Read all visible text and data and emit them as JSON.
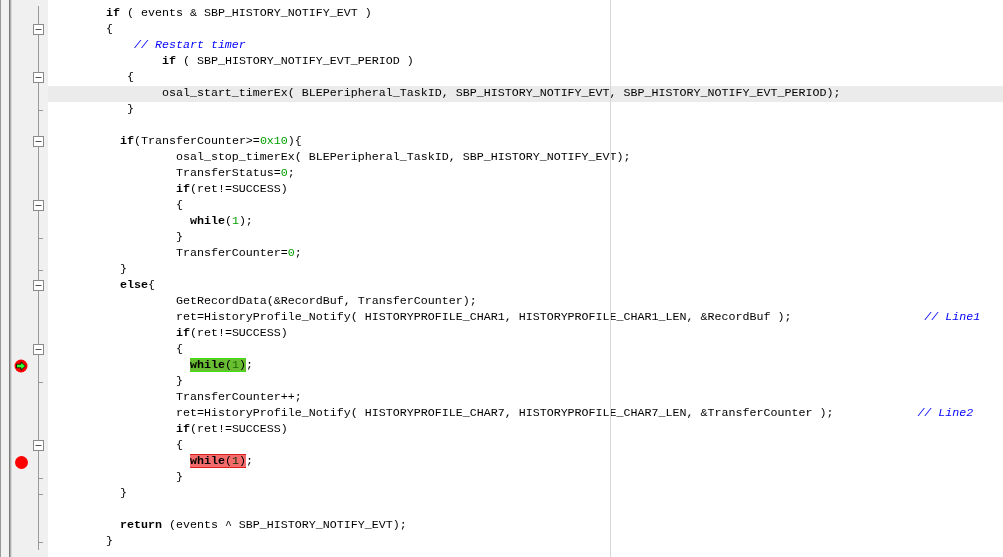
{
  "editor": {
    "lines": [
      {
        "fold_box": false,
        "fold_end": false,
        "breakpoint": false,
        "current": false,
        "cursor": false,
        "tokens": [
          {
            "kind": "keyword",
            "t": "        if"
          },
          {
            "kind": "plain",
            "t": " ( events & SBP_HISTORY_NOTIFY_EVT )"
          }
        ]
      },
      {
        "fold_box": true,
        "fold_end": false,
        "breakpoint": false,
        "current": false,
        "cursor": false,
        "tokens": [
          {
            "kind": "plain",
            "t": "        {"
          }
        ]
      },
      {
        "fold_box": false,
        "fold_end": false,
        "breakpoint": false,
        "current": false,
        "cursor": false,
        "tokens": [
          {
            "kind": "comment",
            "t": "            // Restart timer"
          }
        ]
      },
      {
        "fold_box": false,
        "fold_end": false,
        "breakpoint": false,
        "current": false,
        "cursor": false,
        "tokens": [
          {
            "kind": "keyword",
            "t": "                if"
          },
          {
            "kind": "plain",
            "t": " ( SBP_HISTORY_NOTIFY_EVT_PERIOD )"
          }
        ]
      },
      {
        "fold_box": true,
        "fold_end": false,
        "breakpoint": false,
        "current": false,
        "cursor": false,
        "tokens": [
          {
            "kind": "plain",
            "t": "           {"
          }
        ]
      },
      {
        "fold_box": false,
        "fold_end": false,
        "breakpoint": false,
        "current": false,
        "cursor": true,
        "tokens": [
          {
            "kind": "plain",
            "t": "                osal_start_timerEx( BLEPeripheral_TaskID, SBP_HISTORY_NOTIFY_EVT, SBP_HISTORY_NOTIFY_EVT_PERIOD);"
          }
        ]
      },
      {
        "fold_box": false,
        "fold_end": true,
        "breakpoint": false,
        "current": false,
        "cursor": false,
        "tokens": [
          {
            "kind": "plain",
            "t": "           }"
          }
        ]
      },
      {
        "fold_box": false,
        "fold_end": false,
        "breakpoint": false,
        "current": false,
        "cursor": false
      },
      {
        "fold_box": true,
        "fold_end": false,
        "breakpoint": false,
        "current": false,
        "cursor": false,
        "tokens": [
          {
            "kind": "keyword",
            "t": "          if"
          },
          {
            "kind": "plain",
            "t": "(TransferCounter>="
          },
          {
            "kind": "number",
            "t": "0x10"
          },
          {
            "kind": "plain",
            "t": "){"
          }
        ]
      },
      {
        "fold_box": false,
        "fold_end": false,
        "breakpoint": false,
        "current": false,
        "cursor": false,
        "tokens": [
          {
            "kind": "plain",
            "t": "                  osal_stop_timerEx( BLEPeripheral_TaskID, SBP_HISTORY_NOTIFY_EVT);"
          }
        ]
      },
      {
        "fold_box": false,
        "fold_end": false,
        "breakpoint": false,
        "current": false,
        "cursor": false,
        "tokens": [
          {
            "kind": "plain",
            "t": "                  TransferStatus="
          },
          {
            "kind": "number",
            "t": "0"
          },
          {
            "kind": "plain",
            "t": ";"
          }
        ]
      },
      {
        "fold_box": false,
        "fold_end": false,
        "breakpoint": false,
        "current": false,
        "cursor": false,
        "tokens": [
          {
            "kind": "keyword",
            "t": "                  if"
          },
          {
            "kind": "plain",
            "t": "(ret!=SUCCESS)"
          }
        ]
      },
      {
        "fold_box": true,
        "fold_end": false,
        "breakpoint": false,
        "current": false,
        "cursor": false,
        "tokens": [
          {
            "kind": "plain",
            "t": "                  {"
          }
        ]
      },
      {
        "fold_box": false,
        "fold_end": false,
        "breakpoint": false,
        "current": false,
        "cursor": false,
        "tokens": [
          {
            "kind": "keyword",
            "t": "                    while"
          },
          {
            "kind": "plain",
            "t": "("
          },
          {
            "kind": "number",
            "t": "1"
          },
          {
            "kind": "plain",
            "t": ");"
          }
        ]
      },
      {
        "fold_box": false,
        "fold_end": true,
        "breakpoint": false,
        "current": false,
        "cursor": false,
        "tokens": [
          {
            "kind": "plain",
            "t": "                  }"
          }
        ]
      },
      {
        "fold_box": false,
        "fold_end": false,
        "breakpoint": false,
        "current": false,
        "cursor": false,
        "tokens": [
          {
            "kind": "plain",
            "t": "                  TransferCounter="
          },
          {
            "kind": "number",
            "t": "0"
          },
          {
            "kind": "plain",
            "t": ";"
          }
        ]
      },
      {
        "fold_box": false,
        "fold_end": true,
        "breakpoint": false,
        "current": false,
        "cursor": false,
        "tokens": [
          {
            "kind": "plain",
            "t": "          }"
          }
        ]
      },
      {
        "fold_box": true,
        "fold_end": false,
        "breakpoint": false,
        "current": false,
        "cursor": false,
        "tokens": [
          {
            "kind": "keyword",
            "t": "          else"
          },
          {
            "kind": "plain",
            "t": "{"
          }
        ]
      },
      {
        "fold_box": false,
        "fold_end": false,
        "breakpoint": false,
        "current": false,
        "cursor": false,
        "tokens": [
          {
            "kind": "plain",
            "t": "                  GetRecordData(&RecordBuf, TransferCounter);"
          }
        ]
      },
      {
        "fold_box": false,
        "fold_end": false,
        "breakpoint": false,
        "current": false,
        "cursor": false,
        "tokens": [
          {
            "kind": "plain",
            "t": "                  ret=HistoryProfile_Notify( HISTORYPROFILE_CHAR1, HISTORYPROFILE_CHAR1_LEN, &RecordBuf );"
          },
          {
            "kind": "comment",
            "t": "                   // Line1"
          }
        ]
      },
      {
        "fold_box": false,
        "fold_end": false,
        "breakpoint": false,
        "current": false,
        "cursor": false,
        "tokens": [
          {
            "kind": "keyword",
            "t": "                  if"
          },
          {
            "kind": "plain",
            "t": "(ret!=SUCCESS)"
          }
        ]
      },
      {
        "fold_box": true,
        "fold_end": false,
        "breakpoint": false,
        "current": false,
        "cursor": false,
        "tokens": [
          {
            "kind": "plain",
            "t": "                  {"
          }
        ]
      },
      {
        "fold_box": false,
        "fold_end": false,
        "breakpoint": true,
        "current": true,
        "cursor": false,
        "tokens": [
          {
            "kind": "keyword",
            "t": "                    while",
            "marked": true
          },
          {
            "kind": "plain",
            "t": "(",
            "marked": true
          },
          {
            "kind": "number",
            "t": "1",
            "marked": true
          },
          {
            "kind": "plain",
            "t": ")",
            "marked": true
          },
          {
            "kind": "plain",
            "t": ";",
            "marked": false
          }
        ]
      },
      {
        "fold_box": false,
        "fold_end": true,
        "breakpoint": false,
        "current": false,
        "cursor": false,
        "tokens": [
          {
            "kind": "plain",
            "t": "                  }"
          }
        ]
      },
      {
        "fold_box": false,
        "fold_end": false,
        "breakpoint": false,
        "current": false,
        "cursor": false,
        "tokens": [
          {
            "kind": "plain",
            "t": "                  TransferCounter++;"
          }
        ]
      },
      {
        "fold_box": false,
        "fold_end": false,
        "breakpoint": false,
        "current": false,
        "cursor": false,
        "tokens": [
          {
            "kind": "plain",
            "t": "                  ret=HistoryProfile_Notify( HISTORYPROFILE_CHAR7, HISTORYPROFILE_CHAR7_LEN, &TransferCounter );"
          },
          {
            "kind": "comment",
            "t": "            // Line2"
          }
        ]
      },
      {
        "fold_box": false,
        "fold_end": false,
        "breakpoint": false,
        "current": false,
        "cursor": false,
        "tokens": [
          {
            "kind": "keyword",
            "t": "                  if"
          },
          {
            "kind": "plain",
            "t": "(ret!=SUCCESS)"
          }
        ]
      },
      {
        "fold_box": true,
        "fold_end": false,
        "breakpoint": false,
        "current": false,
        "cursor": false,
        "tokens": [
          {
            "kind": "plain",
            "t": "                  {"
          }
        ]
      },
      {
        "fold_box": false,
        "fold_end": false,
        "breakpoint": true,
        "current": false,
        "cursor": false,
        "tokens": [
          {
            "kind": "keyword",
            "t": "                    while",
            "marked": true
          },
          {
            "kind": "plain",
            "t": "(",
            "marked": true
          },
          {
            "kind": "number",
            "t": "1",
            "marked": true
          },
          {
            "kind": "plain",
            "t": ")",
            "marked": true
          },
          {
            "kind": "plain",
            "t": ";",
            "marked": false
          }
        ]
      },
      {
        "fold_box": false,
        "fold_end": true,
        "breakpoint": false,
        "current": false,
        "cursor": false,
        "tokens": [
          {
            "kind": "plain",
            "t": "                  }"
          }
        ]
      },
      {
        "fold_box": false,
        "fold_end": true,
        "breakpoint": false,
        "current": false,
        "cursor": false,
        "tokens": [
          {
            "kind": "plain",
            "t": "          }"
          }
        ]
      },
      {
        "fold_box": false,
        "fold_end": false,
        "breakpoint": false,
        "current": false,
        "cursor": false
      },
      {
        "fold_box": false,
        "fold_end": false,
        "breakpoint": false,
        "current": false,
        "cursor": false,
        "tokens": [
          {
            "kind": "keyword",
            "t": "          return"
          },
          {
            "kind": "plain",
            "t": " (events ^ SBP_HISTORY_NOTIFY_EVT);"
          }
        ]
      },
      {
        "fold_box": false,
        "fold_end": true,
        "breakpoint": false,
        "current": false,
        "cursor": false,
        "tokens": [
          {
            "kind": "plain",
            "t": "        }"
          }
        ]
      }
    ]
  }
}
